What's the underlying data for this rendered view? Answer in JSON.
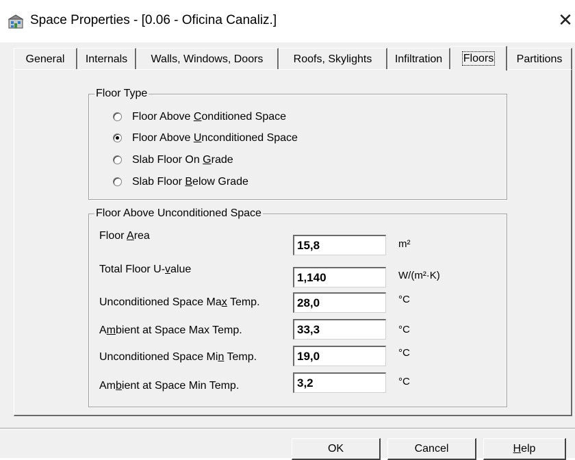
{
  "window": {
    "title": "Space Properties - [0.06 - Oficina Canaliz.]",
    "app_icon": "building-icon",
    "close_glyph": "✕"
  },
  "tabs": [
    {
      "label": "General",
      "active": false
    },
    {
      "label": "Internals",
      "active": false
    },
    {
      "label": "Walls, Windows, Doors",
      "active": false
    },
    {
      "label": "Roofs, Skylights",
      "active": false
    },
    {
      "label": "Infiltration",
      "active": false
    },
    {
      "label": "Floors",
      "active": true
    },
    {
      "label": "Partitions",
      "active": false
    }
  ],
  "floor_type": {
    "legend": "Floor Type",
    "options": [
      {
        "pre": "Floor Above ",
        "mnemonic": "C",
        "post": "onditioned Space",
        "selected": false
      },
      {
        "pre": "Floor Above ",
        "mnemonic": "U",
        "post": "nconditioned Space",
        "selected": true
      },
      {
        "pre": "Slab Floor On ",
        "mnemonic": "G",
        "post": "rade",
        "selected": false
      },
      {
        "pre": "Slab Floor ",
        "mnemonic": "B",
        "post": "elow Grade",
        "selected": false
      }
    ]
  },
  "details": {
    "legend": "Floor Above Unconditioned Space",
    "fields": [
      {
        "pre": "Floor ",
        "mnemonic": "A",
        "post": "rea",
        "value": "15,8",
        "unit": "m²"
      },
      {
        "pre": "Total Floor U-",
        "mnemonic": "v",
        "post": "alue",
        "value": "1,140",
        "unit": "W/(m²·K)"
      },
      {
        "pre": "Unconditioned Space Ma",
        "mnemonic": "x",
        "post": " Temp.",
        "value": "28,0",
        "unit": "°C"
      },
      {
        "pre": "A",
        "mnemonic": "m",
        "post": "bient at Space Max Temp.",
        "value": "33,3",
        "unit": "°C"
      },
      {
        "pre": "Unconditioned Space Mi",
        "mnemonic": "n",
        "post": " Temp.",
        "value": "19,0",
        "unit": "°C"
      },
      {
        "pre": "Am",
        "mnemonic": "b",
        "post": "ient at Space Min Temp.",
        "value": "3,2",
        "unit": "°C"
      }
    ]
  },
  "buttons": {
    "ok": "OK",
    "cancel": "Cancel",
    "help_mnemonic": "H",
    "help_post": "elp"
  }
}
